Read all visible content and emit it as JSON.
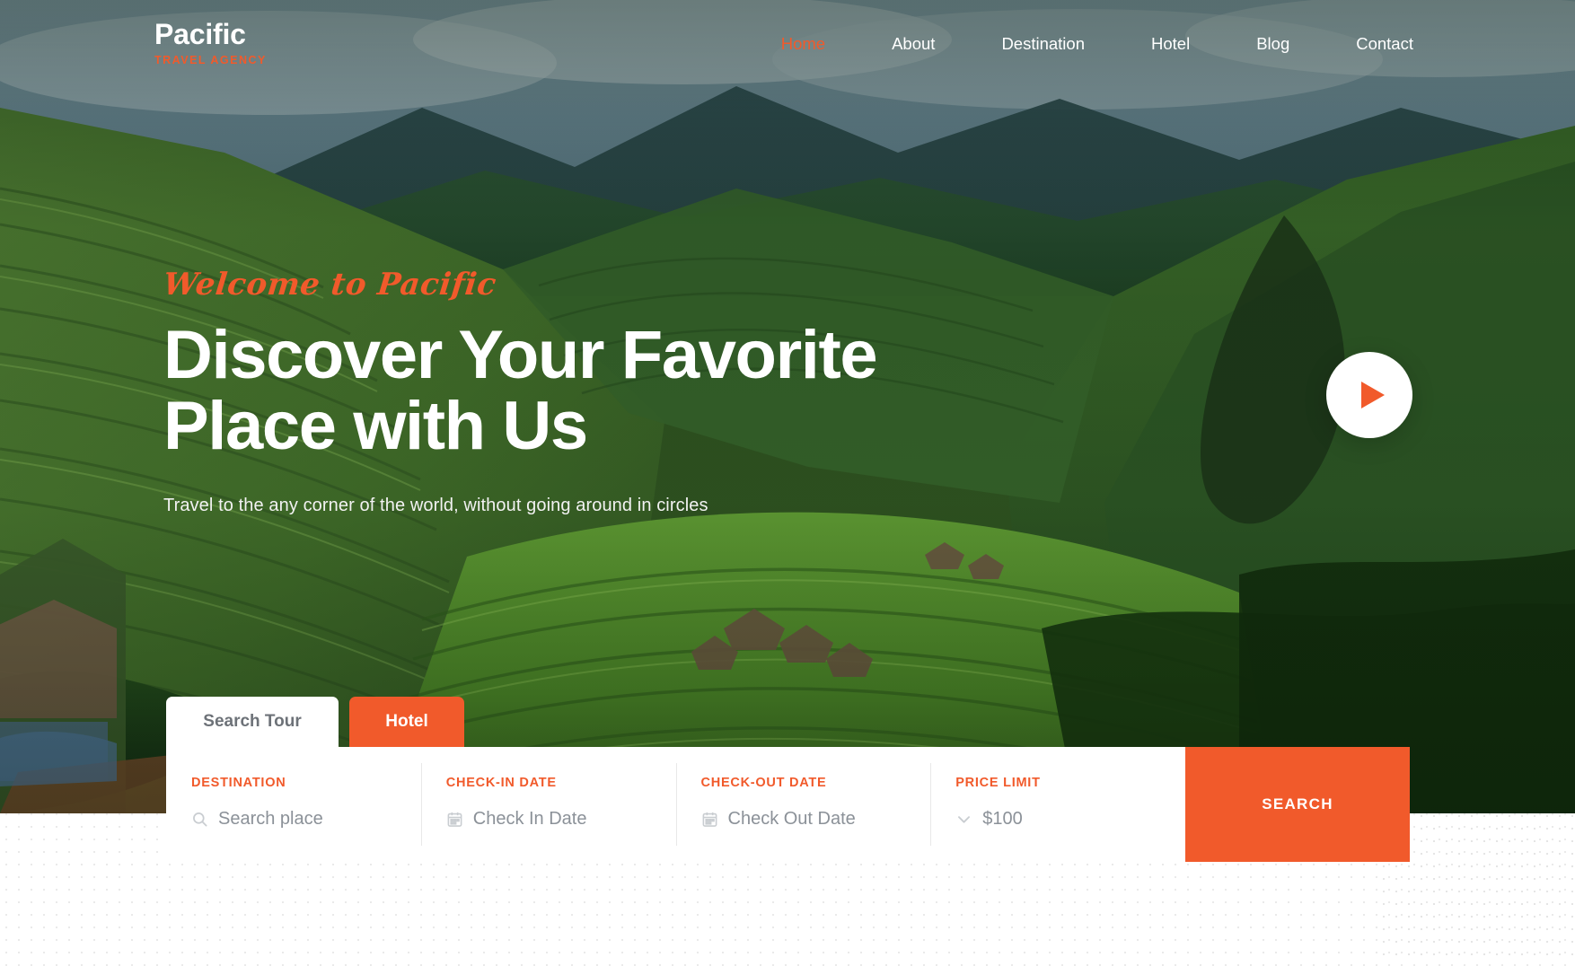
{
  "brand": {
    "name": "Pacific",
    "tagline": "TRAVEL AGENCY",
    "accent_color": "#F15A2B"
  },
  "nav": {
    "items": [
      {
        "label": "Home",
        "active": true
      },
      {
        "label": "About",
        "active": false
      },
      {
        "label": "Destination",
        "active": false
      },
      {
        "label": "Hotel",
        "active": false
      },
      {
        "label": "Blog",
        "active": false
      },
      {
        "label": "Contact",
        "active": false
      }
    ]
  },
  "hero": {
    "eyebrow": "Welcome to Pacific",
    "title_line1": "Discover Your Favorite",
    "title_line2": "Place with Us",
    "subtitle": "Travel to the any corner of the world, without going around in circles",
    "play_button_label": "Play video"
  },
  "search": {
    "tabs": [
      {
        "label": "Search Tour",
        "active": true
      },
      {
        "label": "Hotel",
        "active": false
      }
    ],
    "fields": [
      {
        "label": "DESTINATION",
        "placeholder": "Search place",
        "value": "",
        "icon": "search-icon"
      },
      {
        "label": "CHECK-IN DATE",
        "placeholder": "Check In Date",
        "value": "",
        "icon": "calendar-icon"
      },
      {
        "label": "CHECK-OUT DATE",
        "placeholder": "Check Out Date",
        "value": "",
        "icon": "calendar-icon"
      },
      {
        "label": "PRICE LIMIT",
        "placeholder": "",
        "value": "$100",
        "icon": "chevron-down-icon"
      }
    ],
    "submit_label": "SEARCH"
  }
}
